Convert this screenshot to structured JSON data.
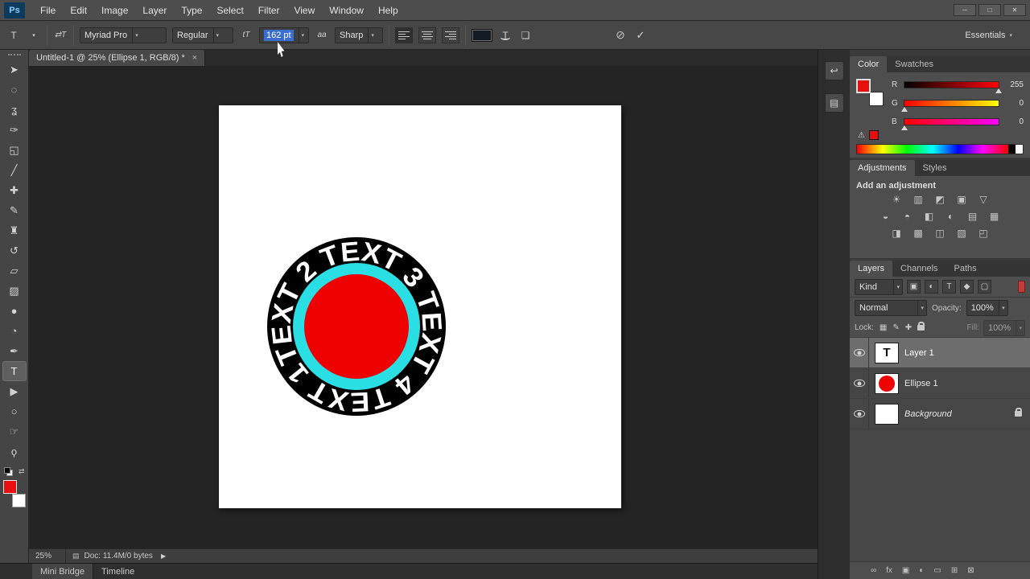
{
  "ui": {
    "combo_arrow": "▾"
  },
  "colors": {
    "foreground": "#e8100e",
    "background": "#ffffff",
    "type_color": "#141b24"
  },
  "menubar": {
    "logo": "Ps",
    "items": [
      "File",
      "Edit",
      "Image",
      "Layer",
      "Type",
      "Select",
      "Filter",
      "View",
      "Window",
      "Help"
    ]
  },
  "window_controls": [
    {
      "name": "minimize",
      "glyph": "─"
    },
    {
      "name": "maximize",
      "glyph": "□"
    },
    {
      "name": "close",
      "glyph": "✕"
    }
  ],
  "options": {
    "tool_preset_glyph": "T",
    "orientation_glyph": "⇄T",
    "font_family": "Myriad Pro",
    "font_style": "Regular",
    "size_glyph": "tT",
    "font_size": "162 pt",
    "aa_glyph": "aa",
    "anti_alias": "Sharp",
    "warp_glyph": "T",
    "panels_glyph": "❏",
    "cancel_glyph": "⊘",
    "commit_glyph": "✓",
    "workspace": "Essentials"
  },
  "toolbar": {
    "swap_glyph": "⇄",
    "tools": [
      {
        "name": "move",
        "glyph": "➤"
      },
      {
        "name": "elliptical-marquee",
        "glyph": "◌"
      },
      {
        "name": "lasso",
        "glyph": "ʓ"
      },
      {
        "name": "quick-selection",
        "glyph": "✑"
      },
      {
        "name": "crop",
        "glyph": "◱"
      },
      {
        "name": "eyedropper",
        "glyph": "╱"
      },
      {
        "name": "healing-brush",
        "glyph": "✚"
      },
      {
        "name": "brush",
        "glyph": "✎"
      },
      {
        "name": "clone-stamp",
        "glyph": "♜"
      },
      {
        "name": "history-brush",
        "glyph": "↺"
      },
      {
        "name": "eraser",
        "glyph": "▱"
      },
      {
        "name": "gradient",
        "glyph": "▨"
      },
      {
        "name": "blur",
        "glyph": "●"
      },
      {
        "name": "dodge",
        "glyph": "◔"
      },
      {
        "name": "pen",
        "glyph": "✒"
      },
      {
        "name": "type",
        "glyph": "T"
      },
      {
        "name": "path-selection",
        "glyph": "▶"
      },
      {
        "name": "ellipse",
        "glyph": "○"
      },
      {
        "name": "hand",
        "glyph": "☞"
      },
      {
        "name": "zoom",
        "glyph": "ϙ"
      }
    ]
  },
  "document": {
    "tab_title": "Untitled-1 @ 25% (Ellipse 1, RGB/8) *",
    "tab_close": "×",
    "zoom": "25%",
    "doc_icon": "▤",
    "doc_info": "Doc: 11.4M/0 bytes",
    "status_arrow": "▶"
  },
  "badge": {
    "text": "TEXT 2 TEXT 3 TEXT 4 TEXT 1 ",
    "outer_color": "#000000",
    "ring_color": "#2adfe4",
    "center_color": "#ee0101",
    "text_color": "#ffffff"
  },
  "color_panel": {
    "tabs": [
      "Color",
      "Swatches"
    ],
    "channels": [
      {
        "label": "R",
        "value": "255"
      },
      {
        "label": "G",
        "value": "0"
      },
      {
        "label": "B",
        "value": "0"
      }
    ],
    "warning_glyph": "⚠"
  },
  "adjustments_panel": {
    "tabs": [
      "Adjustments",
      "Styles"
    ],
    "heading": "Add an adjustment",
    "rows": [
      [
        {
          "name": "brightness-contrast",
          "glyph": "☀"
        },
        {
          "name": "levels",
          "glyph": "▥"
        },
        {
          "name": "curves",
          "glyph": "◩"
        },
        {
          "name": "exposure",
          "glyph": "▣"
        },
        {
          "name": "vibrance",
          "glyph": "▽"
        }
      ],
      [
        {
          "name": "hue-saturation",
          "glyph": "◒"
        },
        {
          "name": "color-balance",
          "glyph": "◓"
        },
        {
          "name": "black-white",
          "glyph": "◧"
        },
        {
          "name": "photo-filter",
          "glyph": "◐"
        },
        {
          "name": "channel-mixer",
          "glyph": "▤"
        },
        {
          "name": "color-lookup",
          "glyph": "▦"
        }
      ],
      [
        {
          "name": "invert",
          "glyph": "◨"
        },
        {
          "name": "posterize",
          "glyph": "▩"
        },
        {
          "name": "threshold",
          "glyph": "◫"
        },
        {
          "name": "gradient-map",
          "glyph": "▧"
        },
        {
          "name": "selective-color",
          "glyph": "◰"
        }
      ]
    ]
  },
  "layers_panel": {
    "tabs": [
      "Layers",
      "Channels",
      "Paths"
    ],
    "kind_label": "Kind",
    "filter_icons": [
      {
        "name": "filter-pixel",
        "glyph": "▣"
      },
      {
        "name": "filter-adjustment",
        "glyph": "◐"
      },
      {
        "name": "filter-type",
        "glyph": "T"
      },
      {
        "name": "filter-shape",
        "glyph": "◆"
      },
      {
        "name": "filter-smart-object",
        "glyph": "▢"
      }
    ],
    "blend_mode": "Normal",
    "opacity_label": "Opacity:",
    "opacity_value": "100%",
    "lock_label": "Lock:",
    "lock_icons": [
      {
        "name": "lock-transparency",
        "glyph": "▦"
      },
      {
        "name": "lock-paint",
        "glyph": "✎"
      },
      {
        "name": "lock-position",
        "glyph": "✚"
      }
    ],
    "fill_label": "Fill:",
    "fill_value": "100%",
    "layers": [
      {
        "name": "Layer 1",
        "thumb_letter": "T"
      },
      {
        "name": "Ellipse 1",
        "thumb_color": "#ee0101"
      },
      {
        "name": "Background"
      }
    ],
    "footer_icons": [
      {
        "name": "link-layers",
        "glyph": "∞"
      },
      {
        "name": "layer-effects",
        "glyph": "fx"
      },
      {
        "name": "add-layer-mask",
        "glyph": "▣"
      },
      {
        "name": "new-adjustment-layer",
        "glyph": "◐"
      },
      {
        "name": "new-group",
        "glyph": "▭"
      },
      {
        "name": "new-layer",
        "glyph": "⊞"
      },
      {
        "name": "delete-layer",
        "glyph": "⊠"
      }
    ]
  },
  "bottom_bar": {
    "tabs": [
      "Mini Bridge",
      "Timeline"
    ]
  },
  "side_dock": [
    {
      "name": "history",
      "glyph": "↩"
    },
    {
      "name": "properties",
      "glyph": "▤"
    }
  ]
}
